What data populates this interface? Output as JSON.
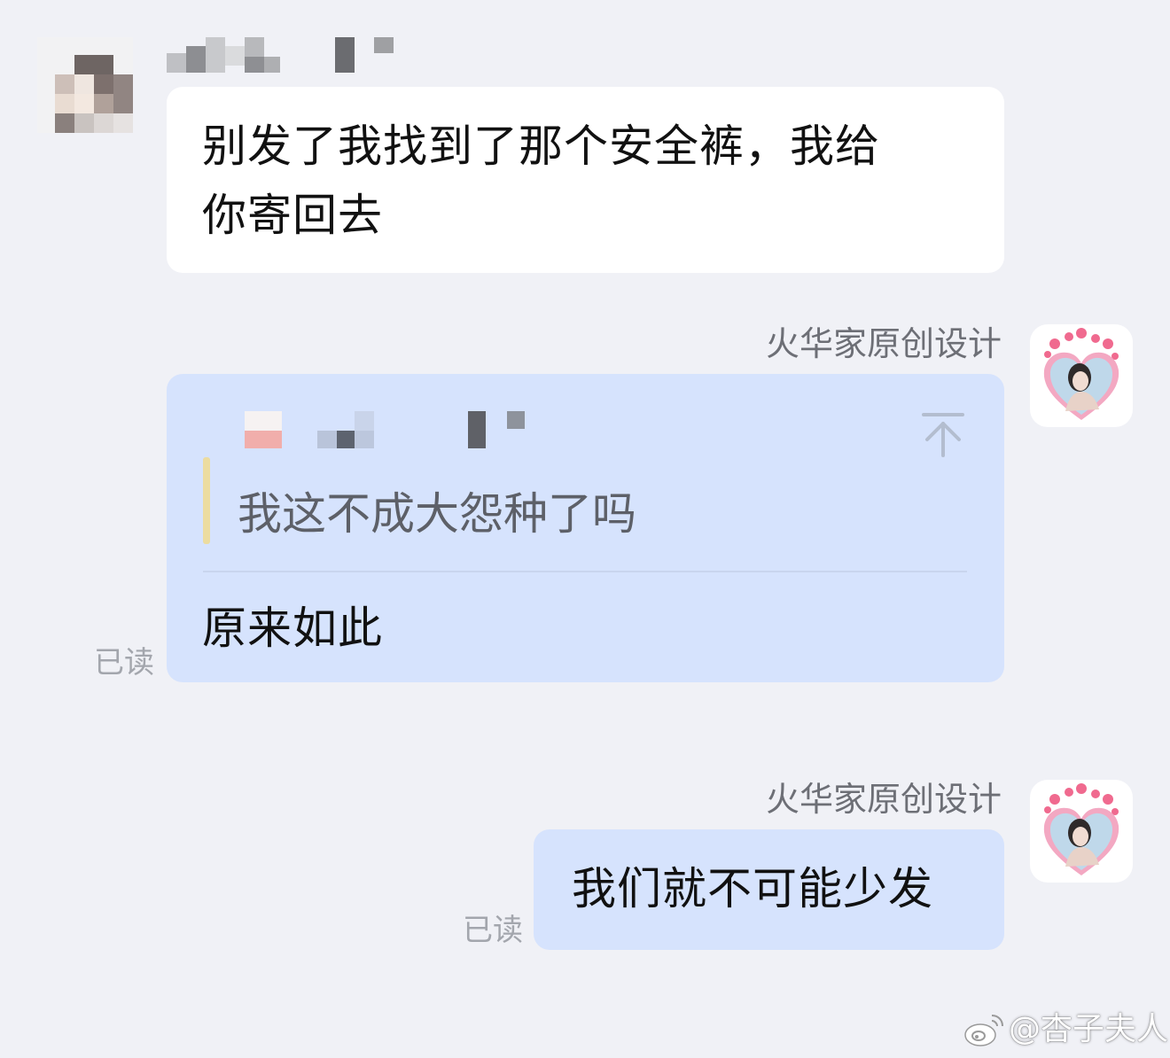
{
  "messages": [
    {
      "text_line1": "别发了我找到了那个安全裤，我给",
      "text_line2": "你寄回去"
    },
    {
      "sender": "火华家原创设计",
      "quote": "我这不成大怨种了吗",
      "text": "原来如此",
      "status": "已读"
    },
    {
      "sender": "火华家原创设计",
      "text": "我们就不可能少发",
      "status": "已读"
    }
  ],
  "colors": {
    "background": "#f0f1f6",
    "incoming_bubble": "#ffffff",
    "outgoing_bubble": "#d6e3fd",
    "quote_bar": "#ecdca0"
  },
  "icons": {
    "quote_jump": "arrow-up-to-top-icon",
    "watermark_logo": "weibo-logo"
  },
  "watermark": "@杏子夫人"
}
